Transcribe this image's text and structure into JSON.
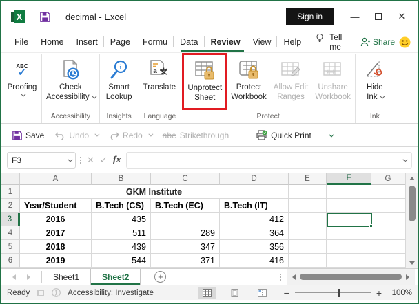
{
  "window": {
    "title": "decimal - Excel",
    "sign_in": "Sign in"
  },
  "menu": {
    "tabs": [
      "File",
      "Home",
      "Insert",
      "Page",
      "Formu",
      "Data",
      "Review",
      "View",
      "Help"
    ],
    "active_tab": "Review",
    "tell_me": "Tell me",
    "share": "Share"
  },
  "ribbon": {
    "proofing": {
      "label": "Proofing",
      "icon_text": "ABC"
    },
    "check_accessibility": {
      "line1": "Check",
      "line2": "Accessibility"
    },
    "smart_lookup": {
      "line1": "Smart",
      "line2": "Lookup"
    },
    "translate": {
      "line1": "Translate"
    },
    "unprotect_sheet": {
      "line1": "Unprotect",
      "line2": "Sheet"
    },
    "protect_workbook": {
      "line1": "Protect",
      "line2": "Workbook"
    },
    "allow_edit_ranges": {
      "line1": "Allow Edit",
      "line2": "Ranges"
    },
    "unshare_workbook": {
      "line1": "Unshare",
      "line2": "Workbook"
    },
    "hide_ink": {
      "line1": "Hide",
      "line2": "Ink"
    },
    "groups": {
      "accessibility": "Accessibility",
      "insights": "Insights",
      "language": "Language",
      "protect": "Protect",
      "ink": "Ink"
    }
  },
  "qat": {
    "save": "Save",
    "undo": "Undo",
    "redo": "Redo",
    "strikethrough": "Strikethrough",
    "strike_icon": "abe",
    "quick_print": "Quick Print"
  },
  "formula_bar": {
    "name_box": "F3",
    "fx": "fx",
    "formula": ""
  },
  "sheet": {
    "col_headers": [
      "A",
      "B",
      "C",
      "D",
      "E",
      "F",
      "G"
    ],
    "row_headers": [
      "1",
      "2",
      "3",
      "4",
      "5",
      "6"
    ],
    "selected_cell": "F3",
    "merged_title": "GKM Institute",
    "header_row": [
      "Year/Student",
      "B.Tech (CS)",
      "B.Tech (EC)",
      "B.Tech (IT)"
    ],
    "data_rows": [
      {
        "year": "2016",
        "cs": "435",
        "ec": "",
        "it": "412"
      },
      {
        "year": "2017",
        "cs": "511",
        "ec": "289",
        "it": "364"
      },
      {
        "year": "2018",
        "cs": "439",
        "ec": "347",
        "it": "356"
      },
      {
        "year": "2019",
        "cs": "544",
        "ec": "371",
        "it": "416"
      }
    ]
  },
  "sheet_tabs": {
    "sheet1": "Sheet1",
    "sheet2": "Sheet2",
    "active": "Sheet2"
  },
  "status_bar": {
    "ready": "Ready",
    "accessibility": "Accessibility: Investigate",
    "zoom": "100%"
  },
  "colors": {
    "excel_green": "#217346",
    "highlight_red": "#E11B22",
    "lock_gold": "#DCA73A",
    "icon_blue": "#2B7CD3",
    "save_purple": "#7030A0"
  }
}
